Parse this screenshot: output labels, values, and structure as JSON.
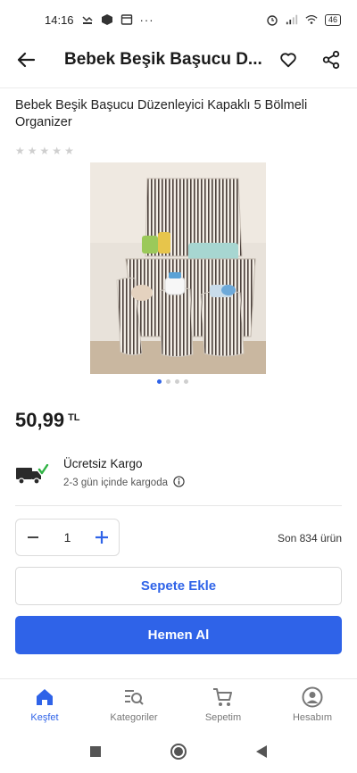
{
  "status_bar": {
    "time": "14:16",
    "battery": "46"
  },
  "app_bar": {
    "title": "Bebek Beşik Başucu D..."
  },
  "product": {
    "title": "Bebek Beşik Başucu Düzenleyici Kapaklı 5 Bölmeli Organizer",
    "rating_stars": 5,
    "image_count": 4,
    "image_active_index": 0,
    "price": "50,99",
    "currency": "TL"
  },
  "shipping": {
    "title": "Ücretsiz Kargo",
    "subtitle": "2-3 gün içinde kargoda"
  },
  "quantity": {
    "value": "1"
  },
  "stock_text": "Son 834 ürün",
  "buttons": {
    "add_to_cart": "Sepete Ekle",
    "buy_now": "Hemen Al"
  },
  "bottom_nav": [
    {
      "label": "Keşfet",
      "icon": "home-icon",
      "active": true
    },
    {
      "label": "Kategoriler",
      "icon": "categories-search-icon",
      "active": false
    },
    {
      "label": "Sepetim",
      "icon": "cart-icon",
      "active": false
    },
    {
      "label": "Hesabım",
      "icon": "account-icon",
      "active": false
    }
  ],
  "colors": {
    "accent": "#2f63e8",
    "check": "#2fb344"
  }
}
